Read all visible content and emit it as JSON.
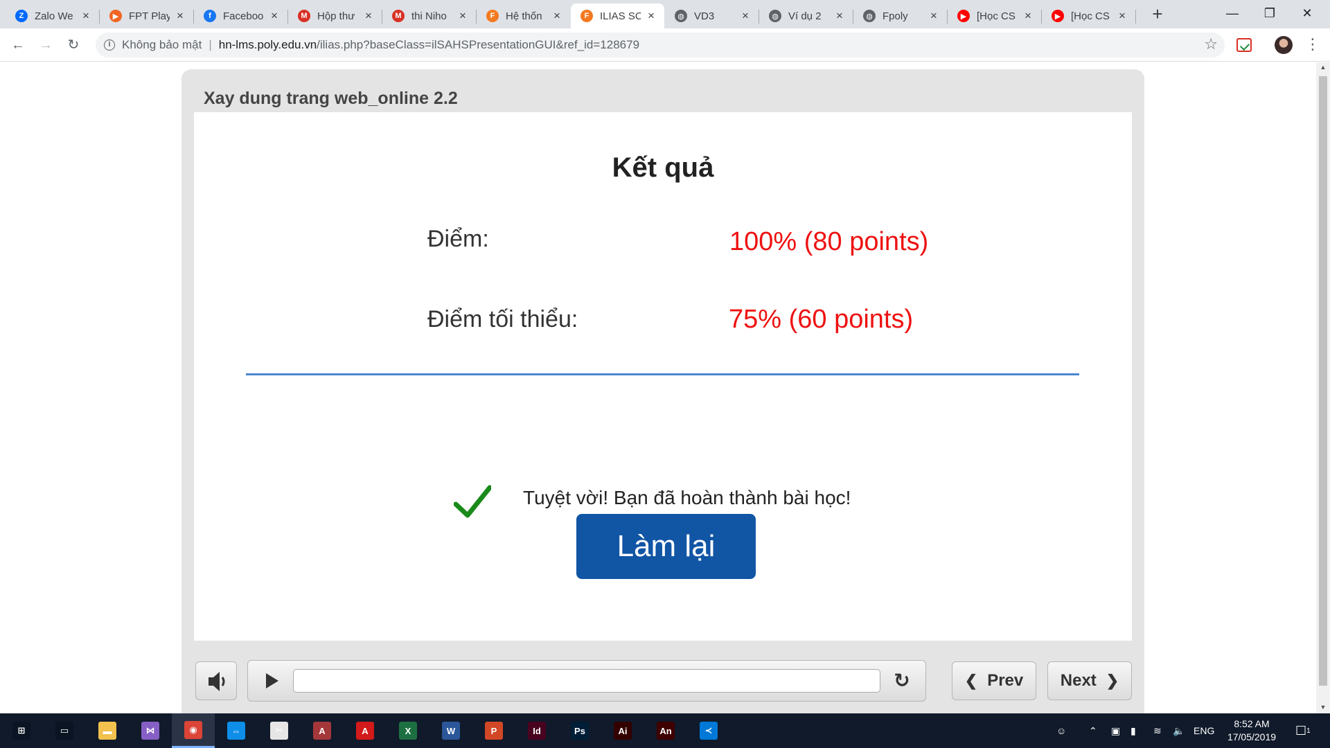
{
  "browser": {
    "tabs": [
      {
        "title": "Zalo We",
        "icon": "zalo-icon",
        "color": "#0068ff",
        "glyph": "Z"
      },
      {
        "title": "FPT Play",
        "icon": "fpt-play-icon",
        "color": "#f26522",
        "glyph": "▶"
      },
      {
        "title": "Faceboo",
        "icon": "facebook-icon",
        "color": "#1877f2",
        "glyph": "f"
      },
      {
        "title": "Hộp thư",
        "icon": "gmail-icon",
        "color": "#d93025",
        "glyph": "M"
      },
      {
        "title": "thi Niho",
        "icon": "gmail-icon",
        "color": "#d93025",
        "glyph": "M"
      },
      {
        "title": "Hệ thốn",
        "icon": "fpt-icon",
        "color": "#f47920",
        "glyph": "F"
      },
      {
        "title": "ILIAS SC",
        "icon": "fpt-icon",
        "color": "#f47920",
        "glyph": "F",
        "active": true
      },
      {
        "title": "VD3",
        "icon": "globe-icon",
        "color": "#5f6368",
        "glyph": "◍"
      },
      {
        "title": "Ví dụ 2",
        "icon": "globe-icon",
        "color": "#5f6368",
        "glyph": "◍"
      },
      {
        "title": "Fpoly",
        "icon": "globe-icon",
        "color": "#5f6368",
        "glyph": "◍"
      },
      {
        "title": "[Học CS",
        "icon": "youtube-icon",
        "color": "#ff0000",
        "glyph": "▶"
      },
      {
        "title": "[Học CS",
        "icon": "youtube-icon",
        "color": "#ff0000",
        "glyph": "▶"
      }
    ],
    "url": {
      "security_label": "Không bảo mật",
      "host": "hn-lms.poly.edu.vn",
      "path": "/ilias.php?baseClass=ilSAHSPresentationGUI&ref_id=128679"
    }
  },
  "player": {
    "title": "Xay dung trang web_online 2.2",
    "result": {
      "heading": "Kết quả",
      "score_label": "Điểm:",
      "score_value": "100% (80 points)",
      "min_label": "Điểm tối thiểu:",
      "min_value": "75% (60 points)",
      "message": "Tuyệt vời! Bạn đã hoàn thành bài học!",
      "retry_label": "Làm lại"
    },
    "controls": {
      "prev_label": "Prev",
      "next_label": "Next",
      "progress": 0
    },
    "colors": {
      "accent": "#1155a5",
      "score": "#ee1111",
      "divider": "#4a86d0",
      "check": "#1a8a1a"
    }
  },
  "taskbar": {
    "apps": [
      {
        "name": "start-icon"
      },
      {
        "name": "task-view-icon"
      },
      {
        "name": "file-explorer-icon"
      },
      {
        "name": "visual-studio-icon"
      },
      {
        "name": "chrome-icon"
      },
      {
        "name": "teamviewer-icon"
      },
      {
        "name": "snipping-tool-icon"
      },
      {
        "name": "access-icon"
      },
      {
        "name": "acrobat-icon"
      },
      {
        "name": "excel-icon"
      },
      {
        "name": "word-icon"
      },
      {
        "name": "powerpoint-icon"
      },
      {
        "name": "indesign-icon"
      },
      {
        "name": "photoshop-icon"
      },
      {
        "name": "illustrator-icon"
      },
      {
        "name": "animate-icon"
      },
      {
        "name": "vscode-icon"
      }
    ],
    "language": "ENG",
    "time": "8:52 AM",
    "date": "17/05/2019",
    "notification_count": "1"
  }
}
